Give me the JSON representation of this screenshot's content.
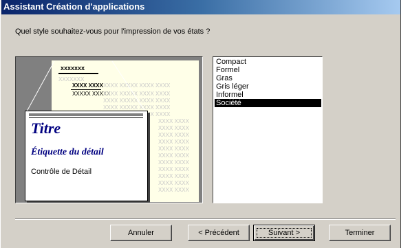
{
  "window": {
    "title": "Assistant Création d'applications"
  },
  "prompt": "Quel style souhaitez-vous pour l'impression de vos états ?",
  "preview": {
    "header_text": "xxxxxxx",
    "title_text": "Titre",
    "label_text": "Étiquette du détail",
    "control_text": "Contrôle de Détail",
    "placeholder_a": "XXXXXXX",
    "placeholder_b": "XXXX XXXX",
    "placeholder_c": "XXXXX XXXXX",
    "placeholder_d": "XXXX XXXXX XXXX XXXX",
    "placeholder_e": "XXXX XXXX"
  },
  "styles_list": {
    "items": [
      "Compact",
      "Formel",
      "Gras",
      "Gris léger",
      "Informel",
      "Société"
    ],
    "selected": "Société"
  },
  "buttons": {
    "cancel": "Annuler",
    "back": "< Précédent",
    "next": "Suivant >",
    "finish": "Terminer"
  }
}
